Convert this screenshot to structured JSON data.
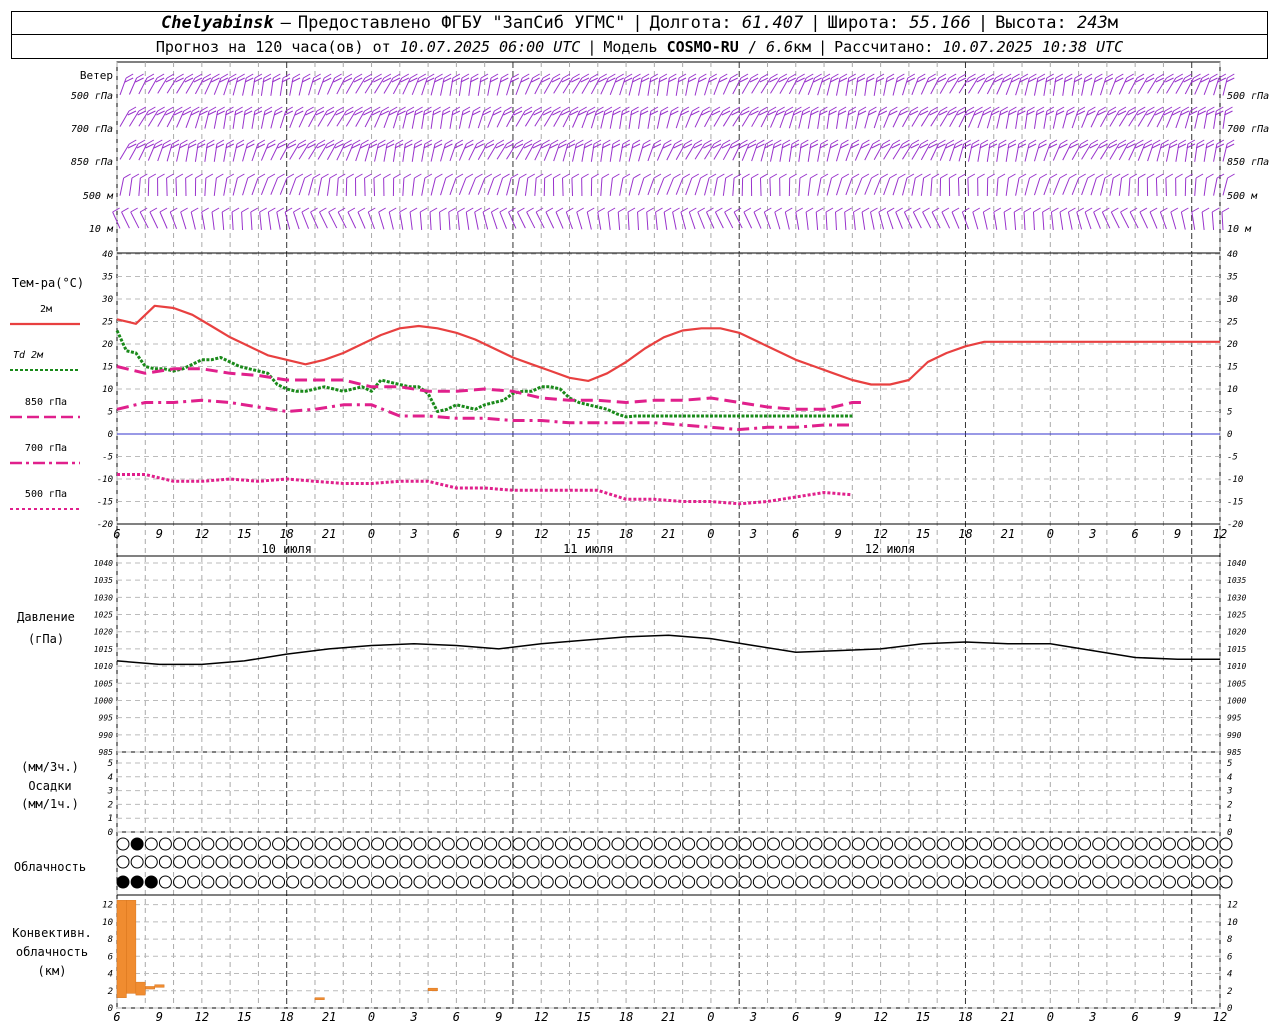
{
  "header": {
    "station": "Chelyabinsk",
    "dash": "—",
    "provider": "Предоставлено ФГБУ \"ЗапСиб УГМС\"",
    "lon_label": "Долгота:",
    "lon": "61.407",
    "lat_label": "Широта:",
    "lat": "55.166",
    "alt_label": "Высота:",
    "alt": "243",
    "alt_unit": "м",
    "forecast_label": "Прогноз на 120 часа(ов) от",
    "forecast_from": "10.07.2025 06:00 UTC",
    "model_label": "Модель",
    "model": "COSMO-RU",
    "model_res": "6.6",
    "model_res_unit": "км",
    "calc_label": "Рассчитано:",
    "calc_time": "10.07.2025 10:38 UTC"
  },
  "labels": {
    "wind": "Ветер",
    "wind_levels": [
      "500 гПа",
      "700 гПа",
      "850 гПа",
      "500 м",
      "10  м"
    ],
    "temp_title": "Тем-ра(°С)",
    "temp_legend": [
      {
        "label": "2м",
        "color": "#e84040"
      },
      {
        "label": "Td  2м",
        "color": "#1a8a1a"
      },
      {
        "label": "850 гПа",
        "color": "#e0208c"
      },
      {
        "label": "700 гПа",
        "color": "#e0208c"
      },
      {
        "label": "500 гПа",
        "color": "#e0208c"
      }
    ],
    "pressure_title": [
      "Давление",
      "(гПа)"
    ],
    "precip_title": [
      "(мм/3ч.)",
      "Осадки",
      "(мм/1ч.)"
    ],
    "cloud_title": "Облачность",
    "conv_title": [
      "Конвективн.",
      "облачность",
      "(км)"
    ],
    "day_labels": [
      "10 июля",
      "11 июля",
      "12 июля"
    ]
  },
  "colors": {
    "wind": "#9933cc",
    "conv": "#f08c30",
    "pressure": "#000000",
    "zero_line": "#3333cc"
  },
  "chart_data": [
    {
      "type": "line",
      "title": "Тем-ра(°С)",
      "x_hours": [
        0,
        3,
        6,
        9,
        12,
        15,
        18,
        21,
        24,
        27,
        30,
        33,
        36,
        39,
        42,
        45,
        48,
        51,
        54,
        57,
        60,
        63,
        66,
        69,
        72,
        75,
        78,
        81,
        84,
        87,
        90,
        93,
        96,
        99,
        102,
        105,
        108,
        111,
        114,
        117,
        120,
        123,
        126,
        129,
        132,
        135,
        138,
        141,
        144,
        147,
        150,
        153,
        156,
        159,
        162,
        165,
        168,
        171,
        174,
        177,
        180,
        183,
        186,
        189,
        192,
        195,
        198,
        201,
        204,
        207,
        210,
        213,
        216,
        219,
        222,
        225,
        228,
        231,
        234
      ],
      "x_tick_labels": [
        "6",
        "9",
        "12",
        "15",
        "18",
        "21",
        "0",
        "3",
        "6",
        "9",
        "12",
        "15",
        "18",
        "21",
        "0",
        "3",
        "6",
        "9",
        "12",
        "15",
        "18",
        "21",
        "0",
        "3",
        "6",
        "9",
        "12"
      ],
      "ylim": [
        -20,
        40
      ],
      "y_ticks": [
        -20,
        -15,
        -10,
        -5,
        0,
        5,
        10,
        15,
        20,
        25,
        30,
        35,
        40
      ],
      "series": [
        {
          "name": "2м",
          "hours": [
            0,
            2,
            4,
            6,
            8,
            10,
            12,
            14,
            16,
            18,
            20,
            22,
            24,
            26,
            28,
            30,
            32,
            34,
            36,
            38,
            40,
            42,
            44,
            46,
            48,
            50,
            52,
            54,
            56,
            58,
            60,
            62,
            64,
            66,
            68,
            70,
            72,
            74,
            76,
            78,
            80,
            82,
            84,
            86,
            88,
            90,
            92,
            94,
            96,
            98,
            100,
            102,
            104,
            106,
            108,
            110,
            112,
            114,
            116,
            117
          ],
          "values": [
            25.5,
            24.5,
            28.5,
            28,
            26.5,
            24,
            21.5,
            19.5,
            17.5,
            16.5,
            15.5,
            16.5,
            18,
            20,
            22,
            23.5,
            24,
            23.5,
            22.5,
            21,
            19,
            17,
            15.5,
            14,
            12.5,
            11.8,
            13.5,
            16,
            19,
            21.5,
            23,
            23.5,
            23.5,
            22.5,
            20.5,
            18.5,
            16.5,
            15,
            13.5,
            12,
            11,
            11,
            12,
            16,
            18,
            19.5,
            20.5,
            20.5,
            20.5,
            20.5,
            20.5,
            20.5,
            20.5,
            20.5,
            20.5,
            20.5,
            20.5,
            20.5,
            20.5,
            20.5
          ]
        },
        {
          "name": "Td  2м",
          "hours": [
            0,
            1,
            2,
            3,
            4,
            5,
            6,
            7,
            8,
            9,
            10,
            11,
            12,
            13,
            14,
            15,
            16,
            17,
            18,
            19,
            20,
            21,
            22,
            23,
            24,
            25,
            26,
            27,
            28,
            29,
            30,
            31,
            32,
            33,
            34,
            35,
            36,
            37,
            38,
            39,
            40,
            41,
            42,
            43,
            44,
            45,
            46,
            47,
            48,
            49,
            50,
            51,
            52,
            53,
            54,
            55,
            56,
            57,
            58,
            59,
            60,
            61,
            62,
            63,
            64,
            65,
            66,
            67,
            68,
            69,
            70,
            71,
            72,
            73,
            74,
            75,
            76,
            77,
            78
          ],
          "values": [
            23,
            18.5,
            18,
            15,
            14.5,
            14.5,
            14,
            14.5,
            15.5,
            16.5,
            16.5,
            17,
            16,
            15,
            14.5,
            14,
            13.5,
            11,
            10,
            9.5,
            9.5,
            10,
            10.5,
            10,
            9.5,
            10,
            10.5,
            9.5,
            12,
            11.5,
            11,
            10.5,
            10.5,
            9,
            5,
            5.5,
            6.5,
            6,
            5.5,
            6.5,
            7,
            7.5,
            9,
            9.5,
            9.5,
            10.5,
            10.5,
            10,
            8,
            7,
            6.5,
            6,
            5.5,
            4.5,
            3.8,
            4,
            4,
            4,
            4,
            4,
            4,
            4,
            4,
            4,
            4,
            4,
            4,
            4,
            4,
            4,
            4,
            4,
            4,
            4,
            4,
            4,
            4,
            4,
            4
          ]
        },
        {
          "name": "850 гПа",
          "hours": [
            0,
            3,
            6,
            9,
            12,
            15,
            18,
            21,
            24,
            27,
            30,
            33,
            36,
            39,
            42,
            45,
            48,
            51,
            54,
            57,
            60,
            63,
            66,
            69,
            72,
            75,
            78,
            79
          ],
          "values": [
            15,
            13.5,
            14.5,
            14.5,
            13.5,
            13,
            12,
            12,
            12,
            10.5,
            10.5,
            9.5,
            9.5,
            10,
            9.5,
            8,
            7.5,
            7.5,
            7,
            7.5,
            7.5,
            8,
            7,
            6,
            5.5,
            5.5,
            7,
            7
          ]
        },
        {
          "name": "700 гПа",
          "hours": [
            0,
            3,
            6,
            9,
            12,
            15,
            18,
            21,
            24,
            27,
            30,
            33,
            36,
            39,
            42,
            45,
            48,
            51,
            54,
            57,
            60,
            63,
            66,
            69,
            72,
            75,
            78
          ],
          "values": [
            5.5,
            7,
            7,
            7.5,
            7,
            6,
            5,
            5.5,
            6.5,
            6.5,
            4,
            4,
            3.5,
            3.5,
            3,
            3,
            2.5,
            2.5,
            2.5,
            2.5,
            2,
            1.5,
            1,
            1.5,
            1.5,
            2,
            2
          ]
        },
        {
          "name": "500 гПа",
          "hours": [
            0,
            3,
            6,
            9,
            12,
            15,
            18,
            21,
            24,
            27,
            30,
            33,
            36,
            39,
            42,
            45,
            48,
            51,
            54,
            57,
            60,
            63,
            66,
            69,
            72,
            75,
            78
          ],
          "values": [
            -9,
            -9,
            -10.5,
            -10.5,
            -10,
            -10.5,
            -10,
            -10.5,
            -11,
            -11,
            -10.5,
            -10.5,
            -12,
            -12,
            -12.5,
            -12.5,
            -12.5,
            -12.5,
            -14.5,
            -14.5,
            -15,
            -15,
            -15.5,
            -15,
            -14,
            -13,
            -13.5
          ]
        }
      ]
    },
    {
      "type": "line",
      "title": "Давление",
      "ylabel": "(гПа)",
      "ylim": [
        985,
        1040
      ],
      "y_ticks": [
        985,
        990,
        995,
        1000,
        1005,
        1010,
        1015,
        1020,
        1025,
        1030,
        1035,
        1040
      ],
      "hours": [
        0,
        3,
        6,
        9,
        12,
        15,
        18,
        21,
        24,
        27,
        30,
        33,
        36,
        39,
        42,
        45,
        48,
        51,
        54,
        57,
        60,
        63,
        66,
        69,
        72,
        75,
        78
      ],
      "values": [
        1011.5,
        1010.5,
        1010.5,
        1011.5,
        1013.5,
        1015,
        1016,
        1016.5,
        1016,
        1015,
        1016.5,
        1017.5,
        1018.5,
        1019,
        1018,
        1016,
        1014,
        1014.5,
        1015,
        1016.5,
        1017,
        1016.5,
        1016.5,
        1014.5,
        1012.5,
        1012,
        1012
      ]
    },
    {
      "type": "bar",
      "title": "Осадки",
      "ylim": [
        0,
        5
      ],
      "y_ticks": [
        0,
        1,
        2,
        3,
        4,
        5
      ],
      "values": []
    },
    {
      "type": "bar",
      "title": "Конвективн. облачность (км)",
      "ylim": [
        0,
        13
      ],
      "y_ticks": [
        0,
        2,
        4,
        6,
        8,
        10,
        12
      ],
      "bars": [
        {
          "hour": 0.5,
          "base": 1.2,
          "top": 12.5
        },
        {
          "hour": 1.5,
          "base": 1.7,
          "top": 12.5
        },
        {
          "hour": 2.5,
          "base": 1.5,
          "top": 3
        },
        {
          "hour": 3.5,
          "base": 2.2,
          "top": 2.5
        },
        {
          "hour": 4.5,
          "base": 2.4,
          "top": 2.7
        },
        {
          "hour": 21.5,
          "base": 1.0,
          "top": 1.2
        },
        {
          "hour": 33.5,
          "base": 2.0,
          "top": 2.3
        }
      ]
    }
  ]
}
